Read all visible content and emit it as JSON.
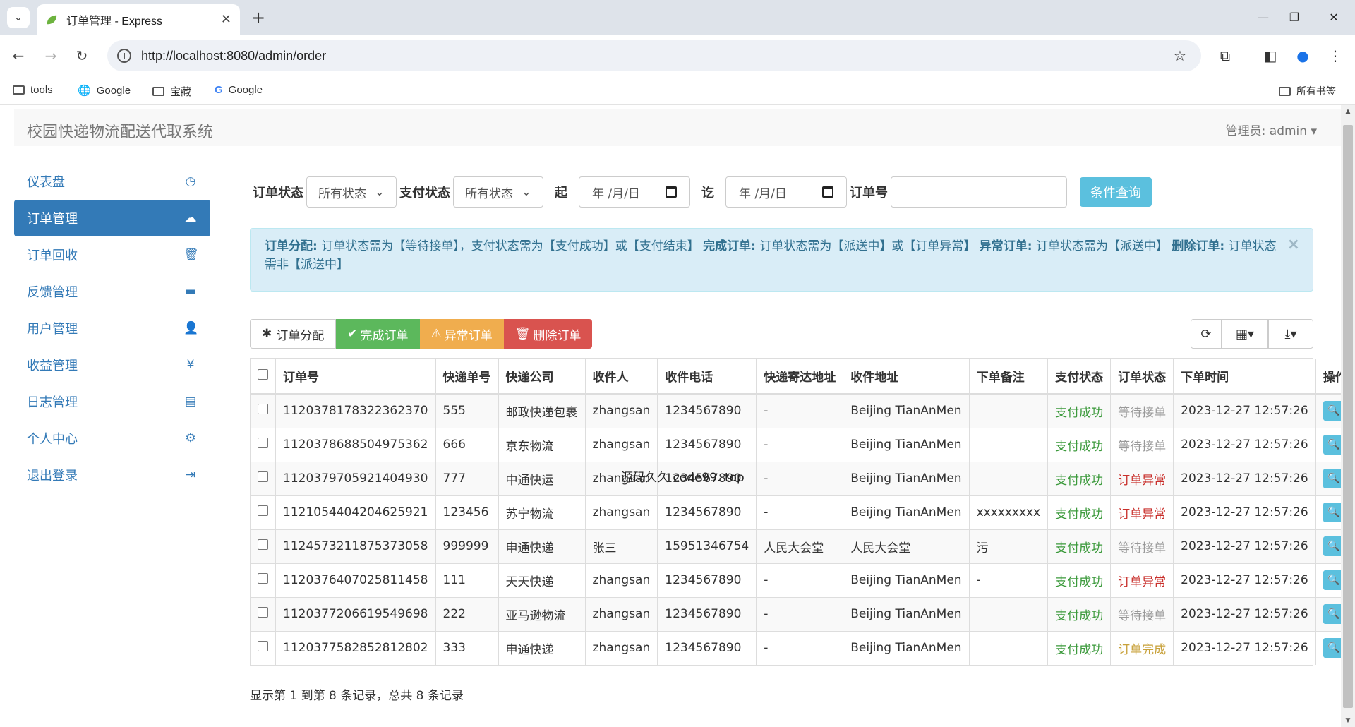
{
  "browser": {
    "tab_title": "订单管理 - Express",
    "url": "http://localhost:8080/admin/order",
    "bookmarks": [
      "tools",
      "Google",
      "宝藏",
      "Google"
    ],
    "all_bookmarks": "所有书签"
  },
  "app": {
    "brand": "校园快递物流配送代取系统",
    "admin_label": "管理员: admin"
  },
  "sidebar": {
    "items": [
      {
        "label": "仪表盘",
        "icon": "dashboard-icon"
      },
      {
        "label": "订单管理",
        "icon": "cloud-upload-icon"
      },
      {
        "label": "订单回收",
        "icon": "trash-icon"
      },
      {
        "label": "反馈管理",
        "icon": "comment-icon"
      },
      {
        "label": "用户管理",
        "icon": "user-icon"
      },
      {
        "label": "收益管理",
        "icon": "yen-icon"
      },
      {
        "label": "日志管理",
        "icon": "list-icon"
      },
      {
        "label": "个人中心",
        "icon": "gear-icon"
      },
      {
        "label": "退出登录",
        "icon": "logout-icon"
      }
    ]
  },
  "filters": {
    "order_status_label": "订单状态",
    "order_status_value": "所有状态",
    "pay_status_label": "支付状态",
    "pay_status_value": "所有状态",
    "from_label": "起",
    "from_value": "年 /月/日",
    "to_label": "讫",
    "to_value": "年 /月/日",
    "order_no_label": "订单号",
    "order_no_value": "",
    "query_button": "条件查询"
  },
  "alert": {
    "t1": "订单分配:",
    "d1": " 订单状态需为【等待接单】，支付状态需为【支付成功】或【支付结束】",
    "t2": "完成订单:",
    "d2": " 订单状态需为【派送中】或【订单异常】",
    "t3": "异常订单:",
    "d3": " 订单状态需为【派送中】",
    "t4": "删除订单:",
    "d4": " 订单状态需非【派送中】",
    "close": "×"
  },
  "toolbar": {
    "assign": "订单分配",
    "complete": "完成订单",
    "abnormal": "异常订单",
    "delete": "删除订单"
  },
  "table": {
    "headers": [
      "订单号",
      "快递单号",
      "快递公司",
      "收件人",
      "收件电话",
      "快递寄达地址",
      "收件地址",
      "下单备注",
      "支付状态",
      "订单状态",
      "下单时间",
      "操作"
    ],
    "rows": [
      {
        "no": "1120378178322362370",
        "exp": "555",
        "company": "邮政快递包裹",
        "name": "zhangsan",
        "phone": "1234567890",
        "from": "-",
        "addr": "Beijing TianAnMen",
        "remark": "",
        "pay": "支付成功",
        "status": "等待接单",
        "status_cls": "wait",
        "time": "2023-12-27 12:57:26"
      },
      {
        "no": "1120378688504975362",
        "exp": "666",
        "company": "京东物流",
        "name": "zhangsan",
        "phone": "1234567890",
        "from": "-",
        "addr": "Beijing TianAnMen",
        "remark": "",
        "pay": "支付成功",
        "status": "等待接单",
        "status_cls": "wait",
        "time": "2023-12-27 12:57:26"
      },
      {
        "no": "1120379705921404930",
        "exp": "777",
        "company": "中通快运",
        "name": "zhangsan",
        "phone": "1234567890",
        "from": "-",
        "addr": "Beijing TianAnMen",
        "remark": "",
        "pay": "支付成功",
        "status": "订单异常",
        "status_cls": "err",
        "time": "2023-12-27 12:57:26"
      },
      {
        "no": "1121054404204625921",
        "exp": "123456",
        "company": "苏宁物流",
        "name": "zhangsan",
        "phone": "1234567890",
        "from": "-",
        "addr": "Beijing TianAnMen",
        "remark": "xxxxxxxxx",
        "pay": "支付成功",
        "status": "订单异常",
        "status_cls": "err",
        "time": "2023-12-27 12:57:26"
      },
      {
        "no": "1124573211875373058",
        "exp": "999999",
        "company": "申通快递",
        "name": "张三",
        "phone": "15951346754",
        "from": "人民大会堂",
        "addr": "人民大会堂",
        "remark": "污",
        "pay": "支付成功",
        "status": "等待接单",
        "status_cls": "wait",
        "time": "2023-12-27 12:57:26"
      },
      {
        "no": "1120376407025811458",
        "exp": "111",
        "company": "天天快递",
        "name": "zhangsan",
        "phone": "1234567890",
        "from": "-",
        "addr": "Beijing TianAnMen",
        "remark": "-",
        "pay": "支付成功",
        "status": "订单异常",
        "status_cls": "err",
        "time": "2023-12-27 12:57:26"
      },
      {
        "no": "1120377206619549698",
        "exp": "222",
        "company": "亚马逊物流",
        "name": "zhangsan",
        "phone": "1234567890",
        "from": "-",
        "addr": "Beijing TianAnMen",
        "remark": "",
        "pay": "支付成功",
        "status": "等待接单",
        "status_cls": "wait",
        "time": "2023-12-27 12:57:26"
      },
      {
        "no": "1120377582852812802",
        "exp": "333",
        "company": "申通快递",
        "name": "zhangsan",
        "phone": "1234567890",
        "from": "-",
        "addr": "Beijing TianAnMen",
        "remark": "",
        "pay": "支付成功",
        "status": "订单完成",
        "status_cls": "done",
        "time": "2023-12-27 12:57:26"
      }
    ]
  },
  "pagination_info": "显示第 1 到第 8 条记录，总共 8 条记录",
  "overlay_text": "源码久久 code99. top"
}
